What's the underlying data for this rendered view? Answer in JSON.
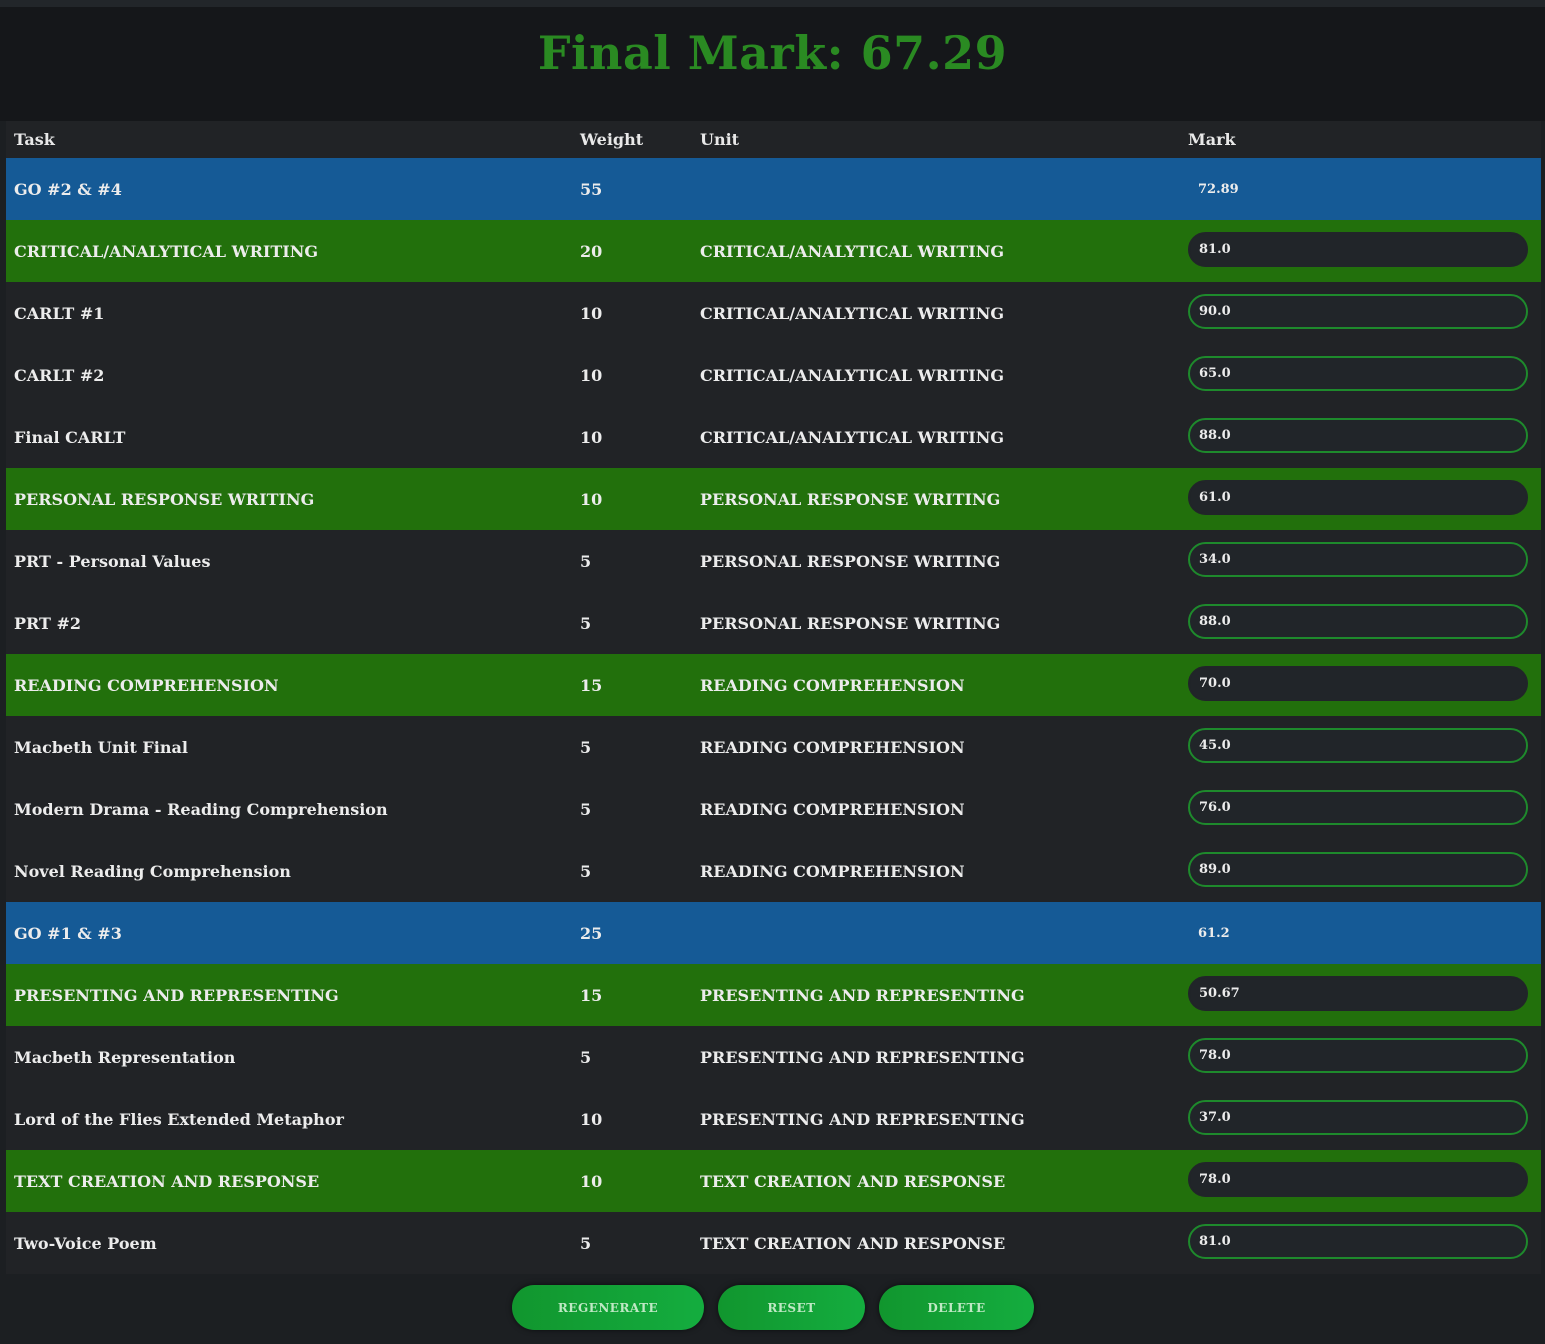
{
  "title": "Final Mark: 67.29",
  "headers": {
    "task": "Task",
    "weight": "Weight",
    "unit": "Unit",
    "mark": "Mark"
  },
  "rows": [
    {
      "type": "group",
      "task": "GO #2 & #4",
      "weight": "55",
      "unit": "",
      "mark": "72.89"
    },
    {
      "type": "unit",
      "task": "CRITICAL/ANALYTICAL WRITING",
      "weight": "20",
      "unit": "CRITICAL/ANALYTICAL WRITING",
      "mark": "81.0"
    },
    {
      "type": "task",
      "task": "CARLT #1",
      "weight": "10",
      "unit": "CRITICAL/ANALYTICAL WRITING",
      "mark": "90.0"
    },
    {
      "type": "task",
      "task": "CARLT #2",
      "weight": "10",
      "unit": "CRITICAL/ANALYTICAL WRITING",
      "mark": "65.0"
    },
    {
      "type": "task",
      "task": "Final CARLT",
      "weight": "10",
      "unit": "CRITICAL/ANALYTICAL WRITING",
      "mark": "88.0"
    },
    {
      "type": "unit",
      "task": "PERSONAL RESPONSE WRITING",
      "weight": "10",
      "unit": "PERSONAL RESPONSE WRITING",
      "mark": "61.0"
    },
    {
      "type": "task",
      "task": "PRT - Personal Values",
      "weight": "5",
      "unit": "PERSONAL RESPONSE WRITING",
      "mark": "34.0"
    },
    {
      "type": "task",
      "task": "PRT #2",
      "weight": "5",
      "unit": "PERSONAL RESPONSE WRITING",
      "mark": "88.0"
    },
    {
      "type": "unit",
      "task": "READING COMPREHENSION",
      "weight": "15",
      "unit": "READING COMPREHENSION",
      "mark": "70.0"
    },
    {
      "type": "task",
      "task": "Macbeth Unit Final",
      "weight": "5",
      "unit": "READING COMPREHENSION",
      "mark": "45.0"
    },
    {
      "type": "task",
      "task": "Modern Drama - Reading Comprehension",
      "weight": "5",
      "unit": "READING COMPREHENSION",
      "mark": "76.0"
    },
    {
      "type": "task",
      "task": "Novel Reading Comprehension",
      "weight": "5",
      "unit": "READING COMPREHENSION",
      "mark": "89.0"
    },
    {
      "type": "group",
      "task": "GO #1 & #3",
      "weight": "25",
      "unit": "",
      "mark": "61.2"
    },
    {
      "type": "unit",
      "task": "PRESENTING AND REPRESENTING",
      "weight": "15",
      "unit": "PRESENTING AND REPRESENTING",
      "mark": "50.67"
    },
    {
      "type": "task",
      "task": "Macbeth Representation",
      "weight": "5",
      "unit": "PRESENTING AND REPRESENTING",
      "mark": "78.0"
    },
    {
      "type": "task",
      "task": "Lord of the Flies Extended Metaphor",
      "weight": "10",
      "unit": "PRESENTING AND REPRESENTING",
      "mark": "37.0"
    },
    {
      "type": "unit",
      "task": "TEXT CREATION AND RESPONSE",
      "weight": "10",
      "unit": "TEXT CREATION AND RESPONSE",
      "mark": "78.0"
    },
    {
      "type": "task",
      "task": "Two-Voice Poem",
      "weight": "5",
      "unit": "TEXT CREATION AND RESPONSE",
      "mark": "81.0"
    }
  ],
  "buttons": {
    "regenerate": "REGENERATE",
    "reset": "RESET",
    "delete": "DELETE"
  },
  "colors": {
    "title": "#2a8a22",
    "group_row": "#155a96",
    "unit_row": "#22700c",
    "task_row": "#212326",
    "button": "#14ad3f"
  }
}
